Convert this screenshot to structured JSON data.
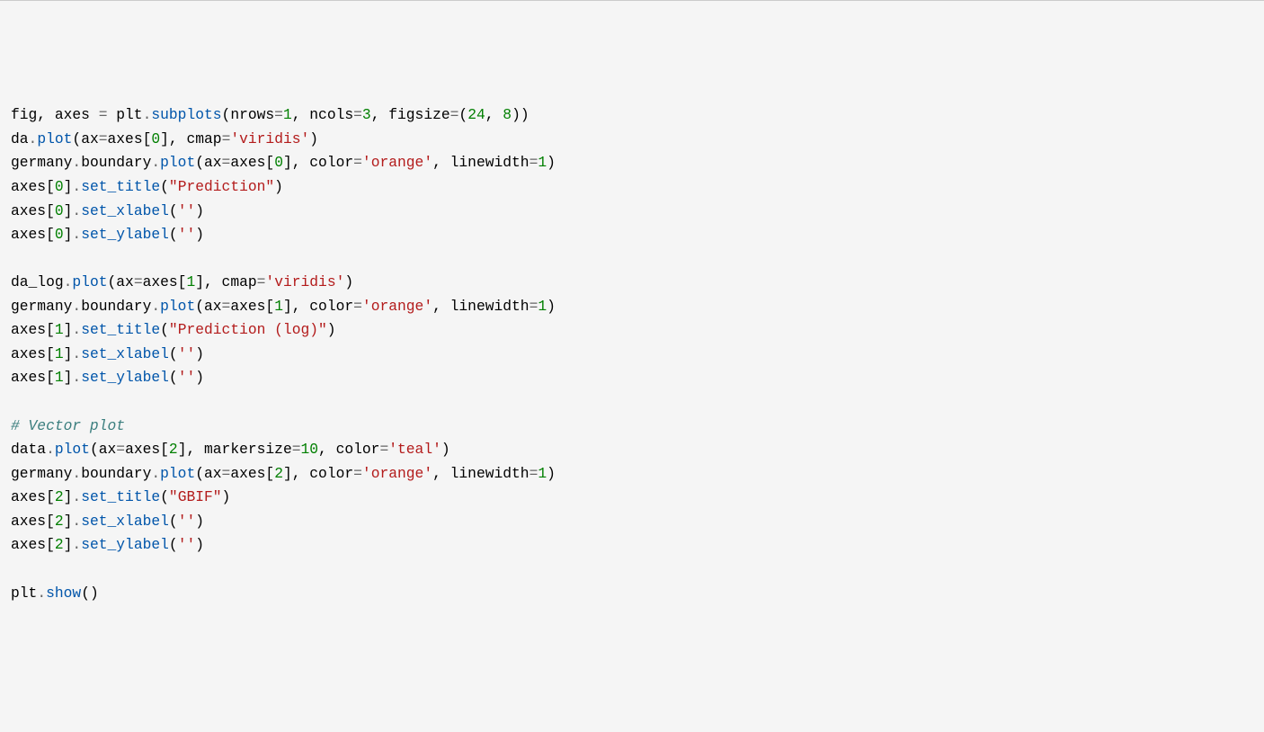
{
  "code": {
    "tokens": [
      {
        "t": "fig, axes ",
        "c": "k-var"
      },
      {
        "t": "=",
        "c": "k-op"
      },
      {
        "t": " plt",
        "c": "k-var"
      },
      {
        "t": ".",
        "c": "k-op"
      },
      {
        "t": "subplots",
        "c": "k-func"
      },
      {
        "t": "(nrows",
        "c": "k-var"
      },
      {
        "t": "=",
        "c": "k-op"
      },
      {
        "t": "1",
        "c": "k-num"
      },
      {
        "t": ", ncols",
        "c": "k-var"
      },
      {
        "t": "=",
        "c": "k-op"
      },
      {
        "t": "3",
        "c": "k-num"
      },
      {
        "t": ", figsize",
        "c": "k-var"
      },
      {
        "t": "=",
        "c": "k-op"
      },
      {
        "t": "(",
        "c": "k-punct"
      },
      {
        "t": "24",
        "c": "k-num"
      },
      {
        "t": ", ",
        "c": "k-punct"
      },
      {
        "t": "8",
        "c": "k-num"
      },
      {
        "t": "))",
        "c": "k-punct"
      },
      {
        "t": "\n",
        "c": ""
      },
      {
        "t": "da",
        "c": "k-var"
      },
      {
        "t": ".",
        "c": "k-op"
      },
      {
        "t": "plot",
        "c": "k-func"
      },
      {
        "t": "(ax",
        "c": "k-var"
      },
      {
        "t": "=",
        "c": "k-op"
      },
      {
        "t": "axes[",
        "c": "k-var"
      },
      {
        "t": "0",
        "c": "k-num"
      },
      {
        "t": "], cmap",
        "c": "k-var"
      },
      {
        "t": "=",
        "c": "k-op"
      },
      {
        "t": "'viridis'",
        "c": "k-str"
      },
      {
        "t": ")",
        "c": "k-punct"
      },
      {
        "t": "\n",
        "c": ""
      },
      {
        "t": "germany",
        "c": "k-var"
      },
      {
        "t": ".",
        "c": "k-op"
      },
      {
        "t": "boundary",
        "c": "k-var"
      },
      {
        "t": ".",
        "c": "k-op"
      },
      {
        "t": "plot",
        "c": "k-func"
      },
      {
        "t": "(ax",
        "c": "k-var"
      },
      {
        "t": "=",
        "c": "k-op"
      },
      {
        "t": "axes[",
        "c": "k-var"
      },
      {
        "t": "0",
        "c": "k-num"
      },
      {
        "t": "], color",
        "c": "k-var"
      },
      {
        "t": "=",
        "c": "k-op"
      },
      {
        "t": "'orange'",
        "c": "k-str"
      },
      {
        "t": ", linewidth",
        "c": "k-var"
      },
      {
        "t": "=",
        "c": "k-op"
      },
      {
        "t": "1",
        "c": "k-num"
      },
      {
        "t": ")",
        "c": "k-punct"
      },
      {
        "t": "\n",
        "c": ""
      },
      {
        "t": "axes[",
        "c": "k-var"
      },
      {
        "t": "0",
        "c": "k-num"
      },
      {
        "t": "]",
        "c": "k-var"
      },
      {
        "t": ".",
        "c": "k-op"
      },
      {
        "t": "set_title",
        "c": "k-func"
      },
      {
        "t": "(",
        "c": "k-punct"
      },
      {
        "t": "\"Prediction\"",
        "c": "k-str"
      },
      {
        "t": ")",
        "c": "k-punct"
      },
      {
        "t": "\n",
        "c": ""
      },
      {
        "t": "axes[",
        "c": "k-var"
      },
      {
        "t": "0",
        "c": "k-num"
      },
      {
        "t": "]",
        "c": "k-var"
      },
      {
        "t": ".",
        "c": "k-op"
      },
      {
        "t": "set_xlabel",
        "c": "k-func"
      },
      {
        "t": "(",
        "c": "k-punct"
      },
      {
        "t": "''",
        "c": "k-str"
      },
      {
        "t": ")",
        "c": "k-punct"
      },
      {
        "t": "\n",
        "c": ""
      },
      {
        "t": "axes[",
        "c": "k-var"
      },
      {
        "t": "0",
        "c": "k-num"
      },
      {
        "t": "]",
        "c": "k-var"
      },
      {
        "t": ".",
        "c": "k-op"
      },
      {
        "t": "set_ylabel",
        "c": "k-func"
      },
      {
        "t": "(",
        "c": "k-punct"
      },
      {
        "t": "''",
        "c": "k-str"
      },
      {
        "t": ")",
        "c": "k-punct"
      },
      {
        "t": "\n",
        "c": ""
      },
      {
        "t": "\n",
        "c": ""
      },
      {
        "t": "da_log",
        "c": "k-var"
      },
      {
        "t": ".",
        "c": "k-op"
      },
      {
        "t": "plot",
        "c": "k-func"
      },
      {
        "t": "(ax",
        "c": "k-var"
      },
      {
        "t": "=",
        "c": "k-op"
      },
      {
        "t": "axes[",
        "c": "k-var"
      },
      {
        "t": "1",
        "c": "k-num"
      },
      {
        "t": "], cmap",
        "c": "k-var"
      },
      {
        "t": "=",
        "c": "k-op"
      },
      {
        "t": "'viridis'",
        "c": "k-str"
      },
      {
        "t": ")",
        "c": "k-punct"
      },
      {
        "t": "\n",
        "c": ""
      },
      {
        "t": "germany",
        "c": "k-var"
      },
      {
        "t": ".",
        "c": "k-op"
      },
      {
        "t": "boundary",
        "c": "k-var"
      },
      {
        "t": ".",
        "c": "k-op"
      },
      {
        "t": "plot",
        "c": "k-func"
      },
      {
        "t": "(ax",
        "c": "k-var"
      },
      {
        "t": "=",
        "c": "k-op"
      },
      {
        "t": "axes[",
        "c": "k-var"
      },
      {
        "t": "1",
        "c": "k-num"
      },
      {
        "t": "], color",
        "c": "k-var"
      },
      {
        "t": "=",
        "c": "k-op"
      },
      {
        "t": "'orange'",
        "c": "k-str"
      },
      {
        "t": ", linewidth",
        "c": "k-var"
      },
      {
        "t": "=",
        "c": "k-op"
      },
      {
        "t": "1",
        "c": "k-num"
      },
      {
        "t": ")",
        "c": "k-punct"
      },
      {
        "t": "\n",
        "c": ""
      },
      {
        "t": "axes[",
        "c": "k-var"
      },
      {
        "t": "1",
        "c": "k-num"
      },
      {
        "t": "]",
        "c": "k-var"
      },
      {
        "t": ".",
        "c": "k-op"
      },
      {
        "t": "set_title",
        "c": "k-func"
      },
      {
        "t": "(",
        "c": "k-punct"
      },
      {
        "t": "\"Prediction (log)\"",
        "c": "k-str"
      },
      {
        "t": ")",
        "c": "k-punct"
      },
      {
        "t": "\n",
        "c": ""
      },
      {
        "t": "axes[",
        "c": "k-var"
      },
      {
        "t": "1",
        "c": "k-num"
      },
      {
        "t": "]",
        "c": "k-var"
      },
      {
        "t": ".",
        "c": "k-op"
      },
      {
        "t": "set_xlabel",
        "c": "k-func"
      },
      {
        "t": "(",
        "c": "k-punct"
      },
      {
        "t": "''",
        "c": "k-str"
      },
      {
        "t": ")",
        "c": "k-punct"
      },
      {
        "t": "\n",
        "c": ""
      },
      {
        "t": "axes[",
        "c": "k-var"
      },
      {
        "t": "1",
        "c": "k-num"
      },
      {
        "t": "]",
        "c": "k-var"
      },
      {
        "t": ".",
        "c": "k-op"
      },
      {
        "t": "set_ylabel",
        "c": "k-func"
      },
      {
        "t": "(",
        "c": "k-punct"
      },
      {
        "t": "''",
        "c": "k-str"
      },
      {
        "t": ")",
        "c": "k-punct"
      },
      {
        "t": "\n",
        "c": ""
      },
      {
        "t": "\n",
        "c": ""
      },
      {
        "t": "# Vector plot",
        "c": "k-comment"
      },
      {
        "t": "\n",
        "c": ""
      },
      {
        "t": "data",
        "c": "k-var"
      },
      {
        "t": ".",
        "c": "k-op"
      },
      {
        "t": "plot",
        "c": "k-func"
      },
      {
        "t": "(ax",
        "c": "k-var"
      },
      {
        "t": "=",
        "c": "k-op"
      },
      {
        "t": "axes[",
        "c": "k-var"
      },
      {
        "t": "2",
        "c": "k-num"
      },
      {
        "t": "], markersize",
        "c": "k-var"
      },
      {
        "t": "=",
        "c": "k-op"
      },
      {
        "t": "10",
        "c": "k-num"
      },
      {
        "t": ", color",
        "c": "k-var"
      },
      {
        "t": "=",
        "c": "k-op"
      },
      {
        "t": "'teal'",
        "c": "k-str"
      },
      {
        "t": ")",
        "c": "k-punct"
      },
      {
        "t": "\n",
        "c": ""
      },
      {
        "t": "germany",
        "c": "k-var"
      },
      {
        "t": ".",
        "c": "k-op"
      },
      {
        "t": "boundary",
        "c": "k-var"
      },
      {
        "t": ".",
        "c": "k-op"
      },
      {
        "t": "plot",
        "c": "k-func"
      },
      {
        "t": "(ax",
        "c": "k-var"
      },
      {
        "t": "=",
        "c": "k-op"
      },
      {
        "t": "axes[",
        "c": "k-var"
      },
      {
        "t": "2",
        "c": "k-num"
      },
      {
        "t": "], color",
        "c": "k-var"
      },
      {
        "t": "=",
        "c": "k-op"
      },
      {
        "t": "'orange'",
        "c": "k-str"
      },
      {
        "t": ", linewidth",
        "c": "k-var"
      },
      {
        "t": "=",
        "c": "k-op"
      },
      {
        "t": "1",
        "c": "k-num"
      },
      {
        "t": ")",
        "c": "k-punct"
      },
      {
        "t": "\n",
        "c": ""
      },
      {
        "t": "axes[",
        "c": "k-var"
      },
      {
        "t": "2",
        "c": "k-num"
      },
      {
        "t": "]",
        "c": "k-var"
      },
      {
        "t": ".",
        "c": "k-op"
      },
      {
        "t": "set_title",
        "c": "k-func"
      },
      {
        "t": "(",
        "c": "k-punct"
      },
      {
        "t": "\"GBIF\"",
        "c": "k-str"
      },
      {
        "t": ")",
        "c": "k-punct"
      },
      {
        "t": "\n",
        "c": ""
      },
      {
        "t": "axes[",
        "c": "k-var"
      },
      {
        "t": "2",
        "c": "k-num"
      },
      {
        "t": "]",
        "c": "k-var"
      },
      {
        "t": ".",
        "c": "k-op"
      },
      {
        "t": "set_xlabel",
        "c": "k-func"
      },
      {
        "t": "(",
        "c": "k-punct"
      },
      {
        "t": "''",
        "c": "k-str"
      },
      {
        "t": ")",
        "c": "k-punct"
      },
      {
        "t": "\n",
        "c": ""
      },
      {
        "t": "axes[",
        "c": "k-var"
      },
      {
        "t": "2",
        "c": "k-num"
      },
      {
        "t": "]",
        "c": "k-var"
      },
      {
        "t": ".",
        "c": "k-op"
      },
      {
        "t": "set_ylabel",
        "c": "k-func"
      },
      {
        "t": "(",
        "c": "k-punct"
      },
      {
        "t": "''",
        "c": "k-str"
      },
      {
        "t": ")",
        "c": "k-punct"
      },
      {
        "t": "\n",
        "c": ""
      },
      {
        "t": "\n",
        "c": ""
      },
      {
        "t": "plt",
        "c": "k-var"
      },
      {
        "t": ".",
        "c": "k-op"
      },
      {
        "t": "show",
        "c": "k-func"
      },
      {
        "t": "()",
        "c": "k-punct"
      }
    ]
  }
}
